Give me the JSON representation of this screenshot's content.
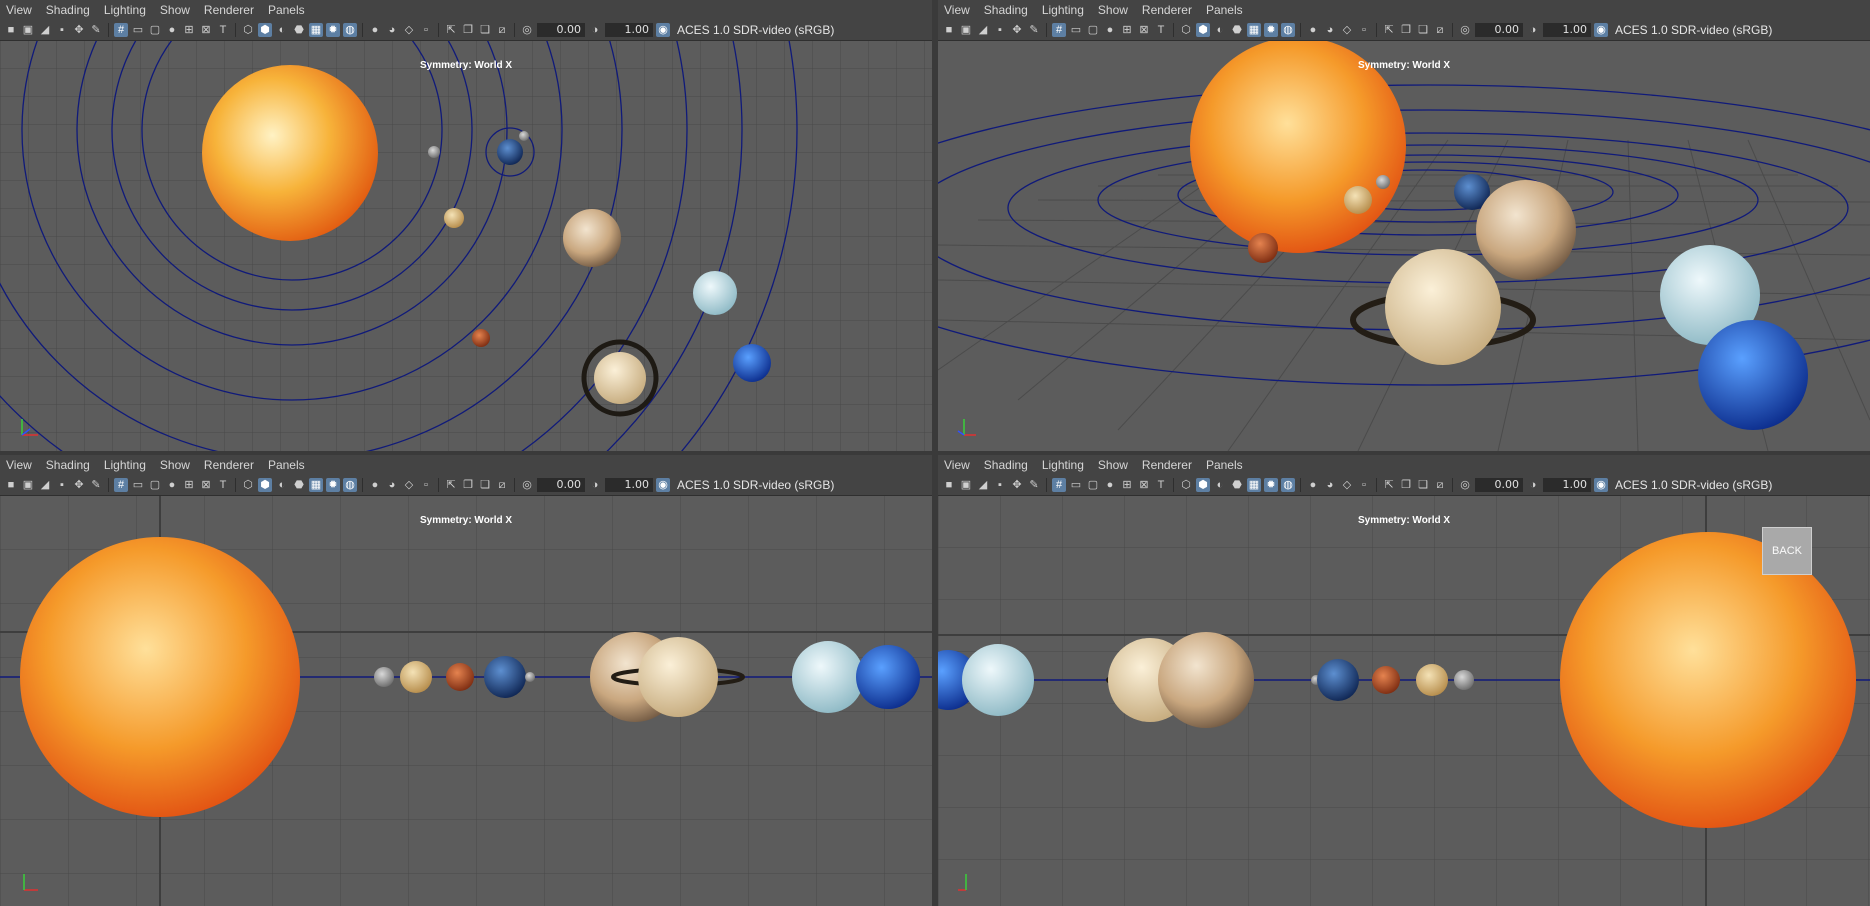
{
  "menu": [
    "View",
    "Shading",
    "Lighting",
    "Show",
    "Renderer",
    "Panels"
  ],
  "toolbar": {
    "exposure": "0.00",
    "gamma": "1.00",
    "color_space": "ACES 1.0 SDR-video (sRGB)"
  },
  "symmetry_label": "Symmetry: World X",
  "back_button": "BACK",
  "viewports": [
    {
      "id": "top",
      "camera": "top view"
    },
    {
      "id": "persp",
      "camera": "perspective view"
    },
    {
      "id": "front",
      "camera": "front view"
    },
    {
      "id": "back",
      "camera": "back view"
    }
  ],
  "colors": {
    "viewport_bg": "#5c5c5c",
    "grid": "#4a4a4a",
    "orbit": "#101a7a",
    "highlight": "#5d7fa3"
  }
}
